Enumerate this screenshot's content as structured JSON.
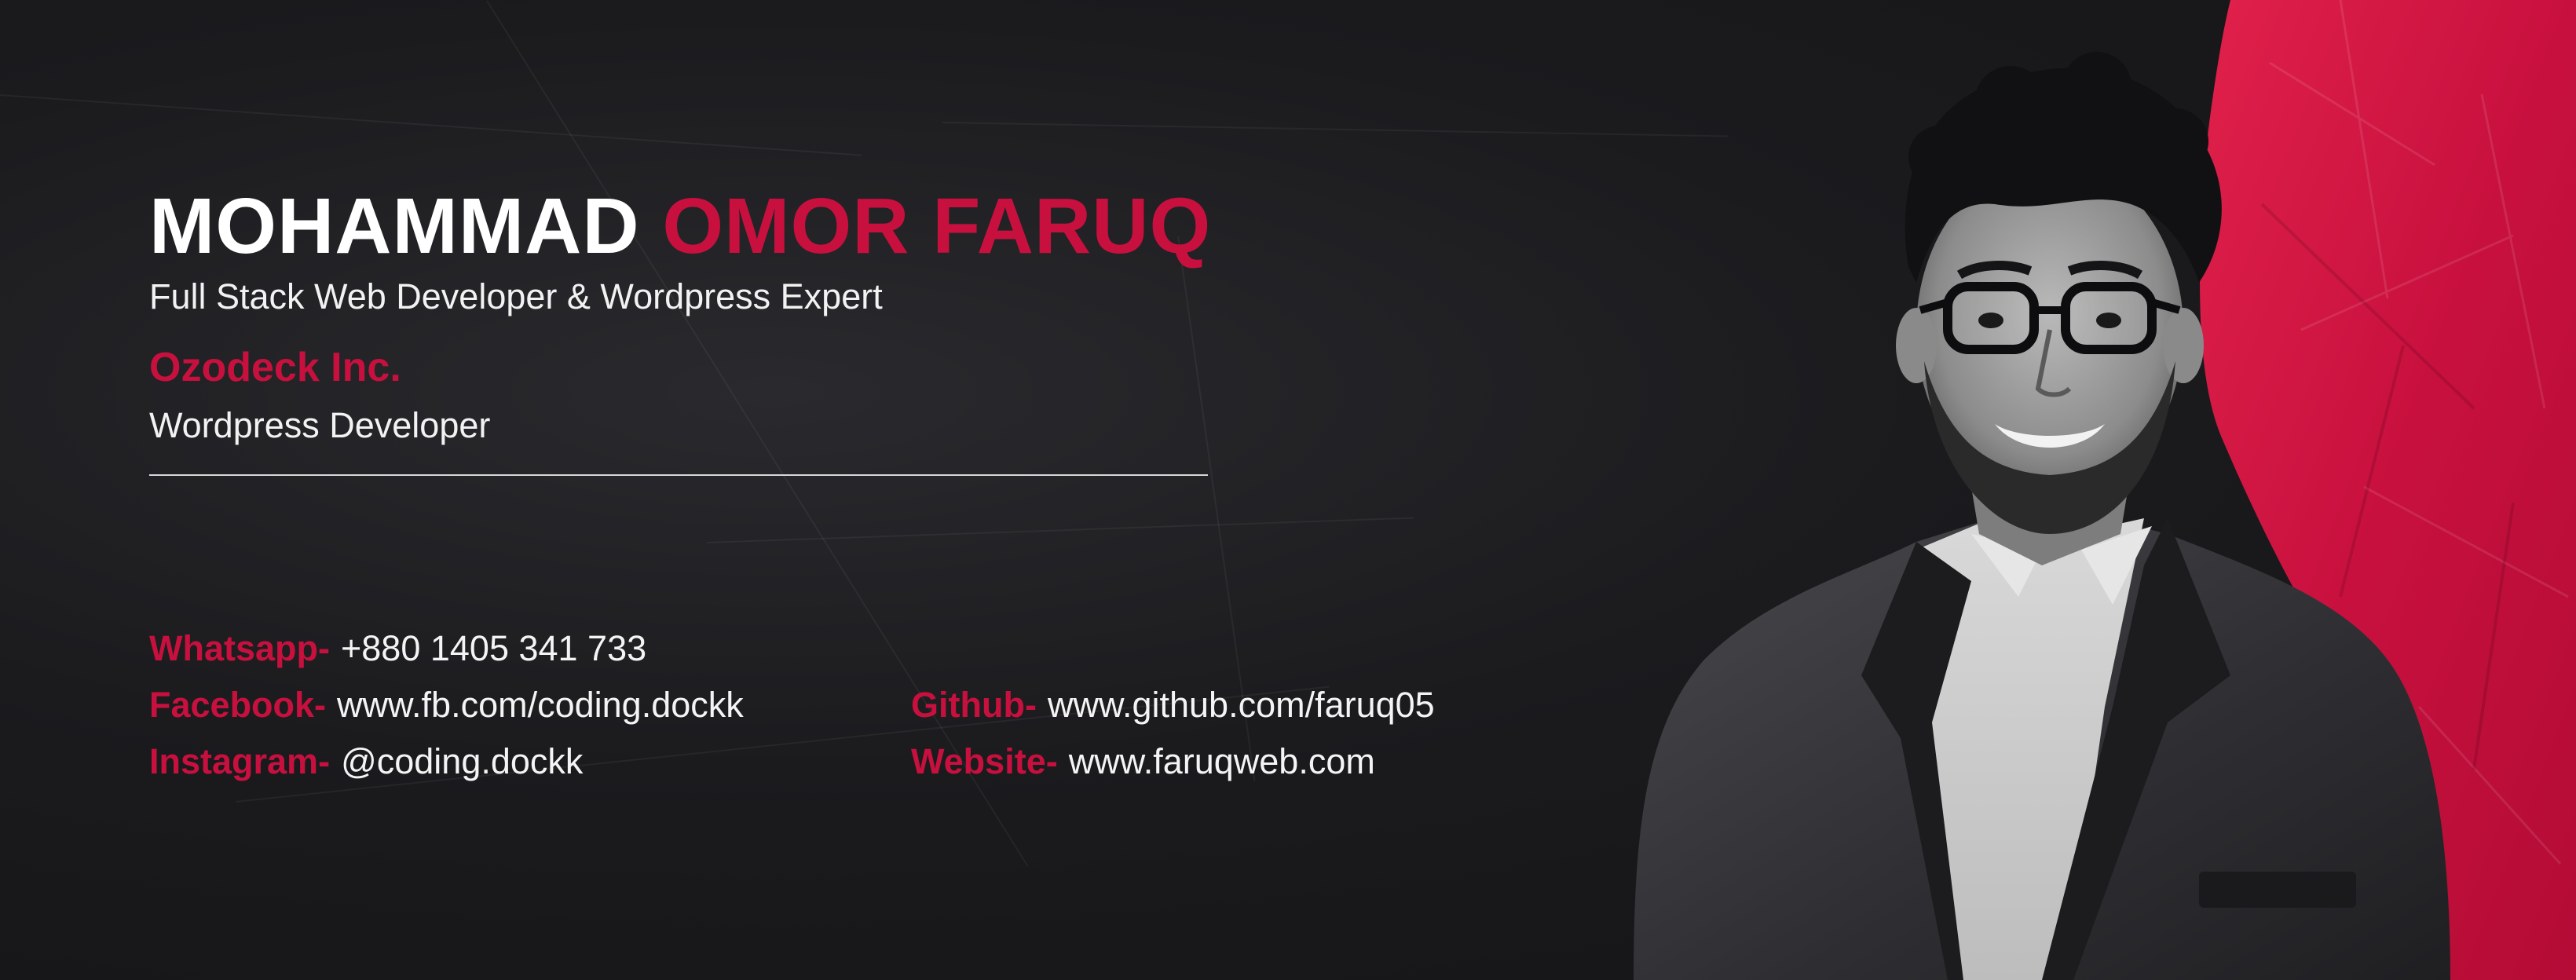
{
  "profile": {
    "name_first": "MOHAMMAD",
    "name_last": "OMOR FARUQ",
    "tagline": "Full Stack Web Developer & Wordpress Expert",
    "company": "Ozodeck Inc.",
    "role": "Wordpress Developer"
  },
  "contacts": {
    "whatsapp": {
      "label": "Whatsapp-",
      "value": "+880 1405 341 733"
    },
    "facebook": {
      "label": "Facebook-",
      "value": "www.fb.com/coding.dockk"
    },
    "instagram": {
      "label": "Instagram-",
      "value": "@coding.dockk"
    },
    "github": {
      "label": "Github-",
      "value": "www.github.com/faruq05"
    },
    "website": {
      "label": "Website-",
      "value": "www.faruqweb.com"
    }
  },
  "colors": {
    "accent": "#c8103e",
    "background": "#1a1a1c",
    "text": "#ffffff"
  },
  "images": {
    "portrait": "person-portrait"
  }
}
